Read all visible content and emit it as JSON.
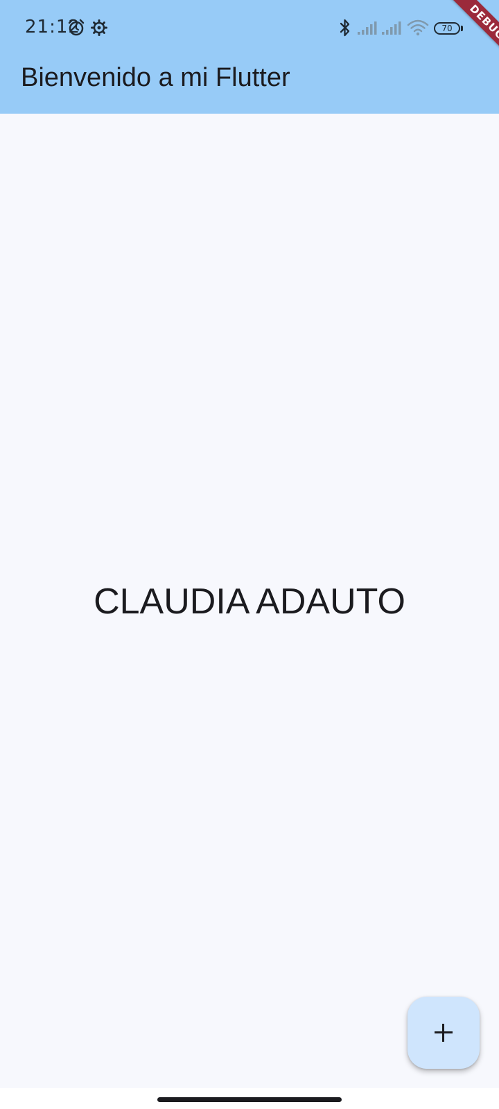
{
  "status_bar": {
    "time": "21:12",
    "battery_level": "70",
    "icons": [
      "alarm-icon",
      "settings-gear-icon",
      "bluetooth-icon",
      "signal-bars-icon",
      "signal-bars-icon",
      "wifi-icon",
      "battery-icon"
    ]
  },
  "debug_banner": {
    "label": "DEBUG"
  },
  "app_bar": {
    "title": "Bienvenido a mi Flutter",
    "background_color": "#97cbf7"
  },
  "main": {
    "text": "CLAUDIA ADAUTO",
    "background_color": "#f7f8fd"
  },
  "fab": {
    "icon": "plus-icon",
    "color": "#cfe5fd"
  },
  "navigation": {
    "indicator": "home-indicator"
  }
}
